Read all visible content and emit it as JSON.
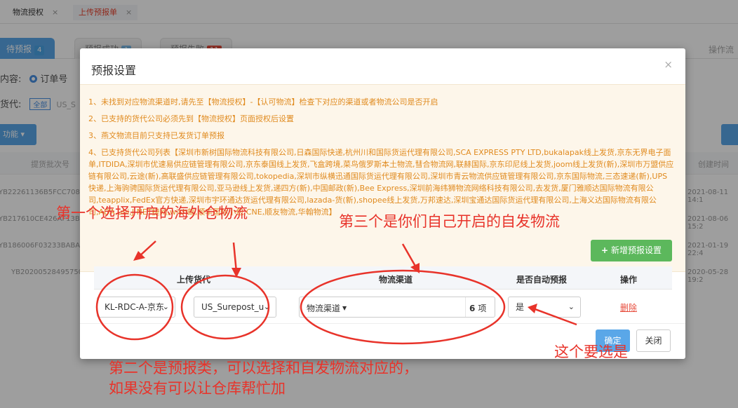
{
  "page_tabs": [
    {
      "label": "物流授权",
      "close": "×"
    },
    {
      "label": "上传预报单",
      "close": "×"
    }
  ],
  "status_tabs": [
    {
      "label": "待预报",
      "count": "4"
    },
    {
      "label": "预报成功",
      "count": "1"
    },
    {
      "label": "预报失败",
      "count": "11"
    }
  ],
  "ops_link": "操作流",
  "filters": {
    "content_label": "内容:",
    "order_no": "订单号",
    "goods_label": "货代:",
    "all_tag": "全部",
    "us_prefix": "US_S"
  },
  "bg_button": "功能",
  "bg_table": {
    "batch_header": "提货批次号",
    "created_header": "创建时间",
    "rows": [
      {
        "batch": "YB22261136B5FCC7082",
        "created": "2021-08-11 14:1"
      },
      {
        "batch": "YB217610CE426AF13B",
        "created": "2021-08-06 15:2"
      },
      {
        "batch": "YB186006F03233BABA",
        "created": "2021-01-19 22:4"
      },
      {
        "batch": "YB20200528495750",
        "created": "2020-05-28 19:2"
      }
    ]
  },
  "modal": {
    "title": "预报设置",
    "close": "×",
    "notices": [
      "1、未找到对应物流渠道时,请先至【物流授权】-【认可物流】检查下对应的渠道或者物流公司是否开启",
      "2、已支持的货代公司必须先到【物流授权】页面授权后设置",
      "3、燕文物流目前只支持已发货订单预报",
      "4、已支持货代公司列表【深圳市新树国际物流科技有限公司,日森国际快递,杭州川和国际货运代理有限公司,SCA EXPRESS PTY LTD,bukalapak线上发货,京东无界电子面单,ITDIDA,深圳市优速易供应链管理有限公司,京东泰国线上发货,飞盒跨境,菜鸟俄罗斯本土物流,彗合物流网,联赫国际,京东印尼线上发货,joom线上发货(新),深圳市万盟供应链有限公司,云途(新),高联盛供应链管理有限公司,tokopedia,深圳市纵横迅通国际货运代理有限公司,深圳市青云物流供应链管理有限公司,京东国际物流,三态速递(新),UPS快递,上海驹骋国际货运代理有限公司,亚马逊线上发货,递四方(新),中国邮政(新),Bee Express,深圳前海纬狮物流网络科技有限公司,去发货,厦门雅顺达国际物流有限公司,teapplix,FedEx官方快递,深圳市宇环通达货运代理有限公司,lazada-货(新),shopee线上发货,万邦速达,深圳宝通达国际货运代理有限公司,上海义达国际物流有限公司,ADA,ubi,J-NET捷网,wish邮,顺丰国际小包,CNE,顺友物流,华翰物流】"
    ],
    "add_button": "新增预报设置",
    "add_plus": "+",
    "columns": {
      "upload": "上传货代",
      "channel": "物流渠道",
      "auto": "是否自动预报",
      "ops": "操作"
    },
    "row": {
      "warehouse": "KL-RDC-A-京东",
      "forecast_type": "US_Surepost_u",
      "channel_label": "物流渠道",
      "channel_caret": "▼",
      "channel_count": "6",
      "channel_unit": "项",
      "auto_value": "是",
      "delete": "删除"
    },
    "confirm": "确定",
    "close_button": "关闭"
  },
  "annotations": {
    "first": "第一个选择开启的海外仓物流",
    "third": "第三个是你们自己开启的自发物流",
    "must_yes": "这个要选是",
    "second_line1": "第二个是预报类，可以选择和自发物流对应的，",
    "second_line2": "如果没有可以让仓库帮忙加"
  },
  "colors": {
    "annotation": "#e8332a",
    "notice_text": "#e08a1e",
    "primary": "#5aa7e8",
    "success": "#5cb85c",
    "danger": "#e74c3c"
  }
}
